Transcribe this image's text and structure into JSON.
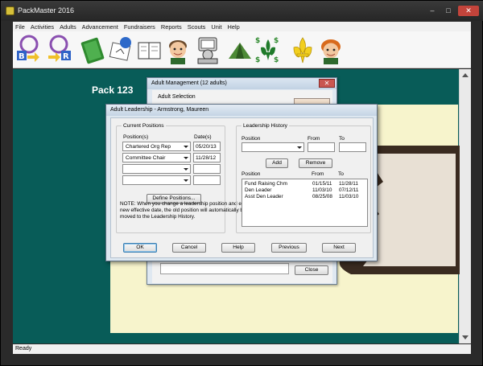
{
  "app": {
    "title": "PackMaster 2016",
    "menu": [
      "File",
      "Activities",
      "Adults",
      "Advancement",
      "Fundraisers",
      "Reports",
      "Scouts",
      "Unit",
      "Help"
    ],
    "toolbar_icons": [
      "bobcat-to-rank-icon",
      "rank-progression-icon",
      "notebook-icon",
      "calendar-plan-icon",
      "address-book-icon",
      "scout-boy-icon",
      "computer-user-icon",
      "tent-icon",
      "money-fleur-de-lis-icon",
      "fleur-de-lis-icon",
      "scout-girl-icon"
    ],
    "status": "Ready",
    "pack_label": "Pack 123",
    "colors": {
      "background": "#085c58",
      "dialog": "#dde7f0",
      "default_button_border": "#3c7fb1"
    }
  },
  "adult_management": {
    "title": "Adult Management  (12 adults)",
    "section": "Adult Selection",
    "close_label": "Close"
  },
  "dialog": {
    "title": "Adult Leadership - Armstrong,  Maureen",
    "current": {
      "group_title": "Current Positions",
      "position_header": "Position(s)",
      "date_header": "Date(s)",
      "rows": [
        {
          "position": "Chartered Org Rep",
          "date": "05/20/13"
        },
        {
          "position": "Committee Chair",
          "date": "11/28/12"
        },
        {
          "position": "",
          "date": ""
        },
        {
          "position": "",
          "date": ""
        }
      ],
      "define_label": "Define Positions...",
      "note": "NOTE: When you change a leadership position and enter a new effective date, the old position will automatically be moved to the Leadership History."
    },
    "history": {
      "group_title": "Leadership History",
      "position_label": "Position",
      "from_label": "From",
      "to_label": "To",
      "position_value": "",
      "from_value": "",
      "to_value": "",
      "add_label": "Add",
      "remove_label": "Remove",
      "columns": [
        "Position",
        "From",
        "To"
      ],
      "rows": [
        {
          "position": "Fund Raising Chm",
          "from": "01/15/11",
          "to": "11/28/11"
        },
        {
          "position": "Den Leader",
          "from": "11/03/10",
          "to": "07/12/11"
        },
        {
          "position": "Asst Den Leader",
          "from": "08/25/08",
          "to": "11/03/10"
        }
      ]
    },
    "buttons": {
      "ok": "OK",
      "cancel": "Cancel",
      "help": "Help",
      "previous": "Previous",
      "next": "Next"
    }
  }
}
